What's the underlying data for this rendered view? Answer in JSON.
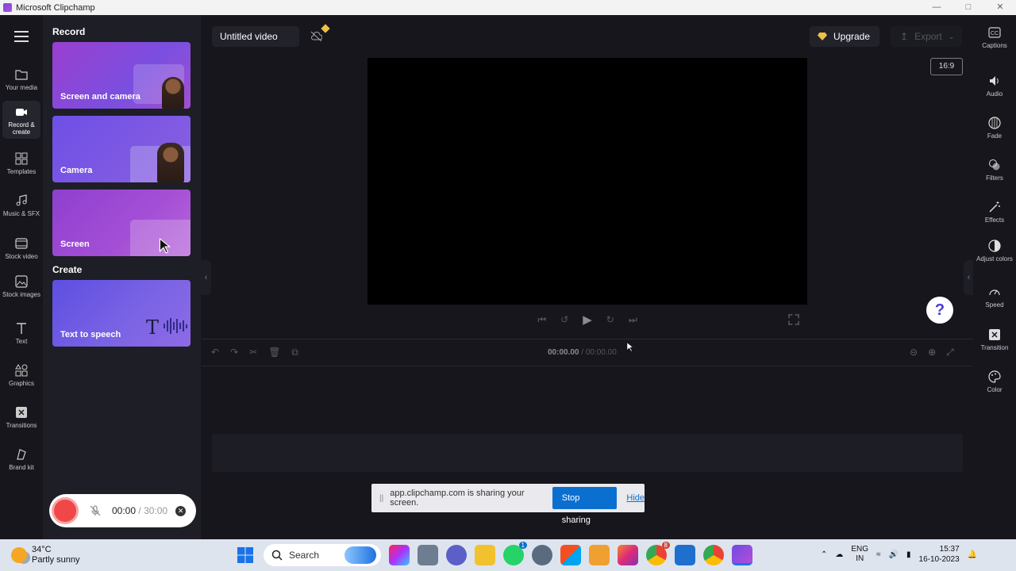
{
  "window": {
    "title": "Microsoft Clipchamp"
  },
  "leftnav": [
    {
      "id": "your-media",
      "label": "Your media"
    },
    {
      "id": "record-create",
      "label": "Record & create",
      "active": true
    },
    {
      "id": "templates",
      "label": "Templates"
    },
    {
      "id": "music-sfx",
      "label": "Music & SFX"
    },
    {
      "id": "stock-video",
      "label": "Stock video"
    },
    {
      "id": "stock-images",
      "label": "Stock images"
    },
    {
      "id": "text",
      "label": "Text"
    },
    {
      "id": "graphics",
      "label": "Graphics"
    },
    {
      "id": "transitions",
      "label": "Transitions"
    },
    {
      "id": "brand-kit",
      "label": "Brand kit"
    }
  ],
  "panel": {
    "record_heading": "Record",
    "create_heading": "Create",
    "cards": {
      "screen_camera": "Screen and camera",
      "camera": "Camera",
      "screen": "Screen",
      "text_to_speech": "Text to speech"
    },
    "recorder": {
      "elapsed": "00:00",
      "separator": "/",
      "limit": "30:00"
    }
  },
  "editor": {
    "project_title": "Untitled video",
    "upgrade_label": "Upgrade",
    "export_label": "Export",
    "aspect_ratio": "16:9",
    "help_label": "?"
  },
  "timeline": {
    "current_time": "00:00.00",
    "separator": "/",
    "duration": "00:00.00"
  },
  "share_bar": {
    "message": "app.clipchamp.com is sharing your screen.",
    "stop_label": "Stop sharing",
    "hide_label": "Hide"
  },
  "rightbar": [
    {
      "id": "captions",
      "label": "Captions"
    },
    {
      "id": "audio",
      "label": "Audio"
    },
    {
      "id": "fade",
      "label": "Fade"
    },
    {
      "id": "filters",
      "label": "Filters"
    },
    {
      "id": "effects",
      "label": "Effects"
    },
    {
      "id": "adjust-colors",
      "label": "Adjust colors"
    },
    {
      "id": "speed",
      "label": "Speed"
    },
    {
      "id": "transition",
      "label": "Transition"
    },
    {
      "id": "color",
      "label": "Color"
    }
  ],
  "taskbar": {
    "temperature": "34°C",
    "weather": "Partly sunny",
    "search_label": "Search",
    "lang_top": "ENG",
    "lang_bottom": "IN",
    "time": "15:37",
    "date": "16-10-2023",
    "whatsapp_badge": "1",
    "chrome_badge": "8"
  },
  "colors": {
    "accent_purple": "#7a4fe0",
    "record_red": "#f04848",
    "share_blue": "#0b6fd0"
  }
}
